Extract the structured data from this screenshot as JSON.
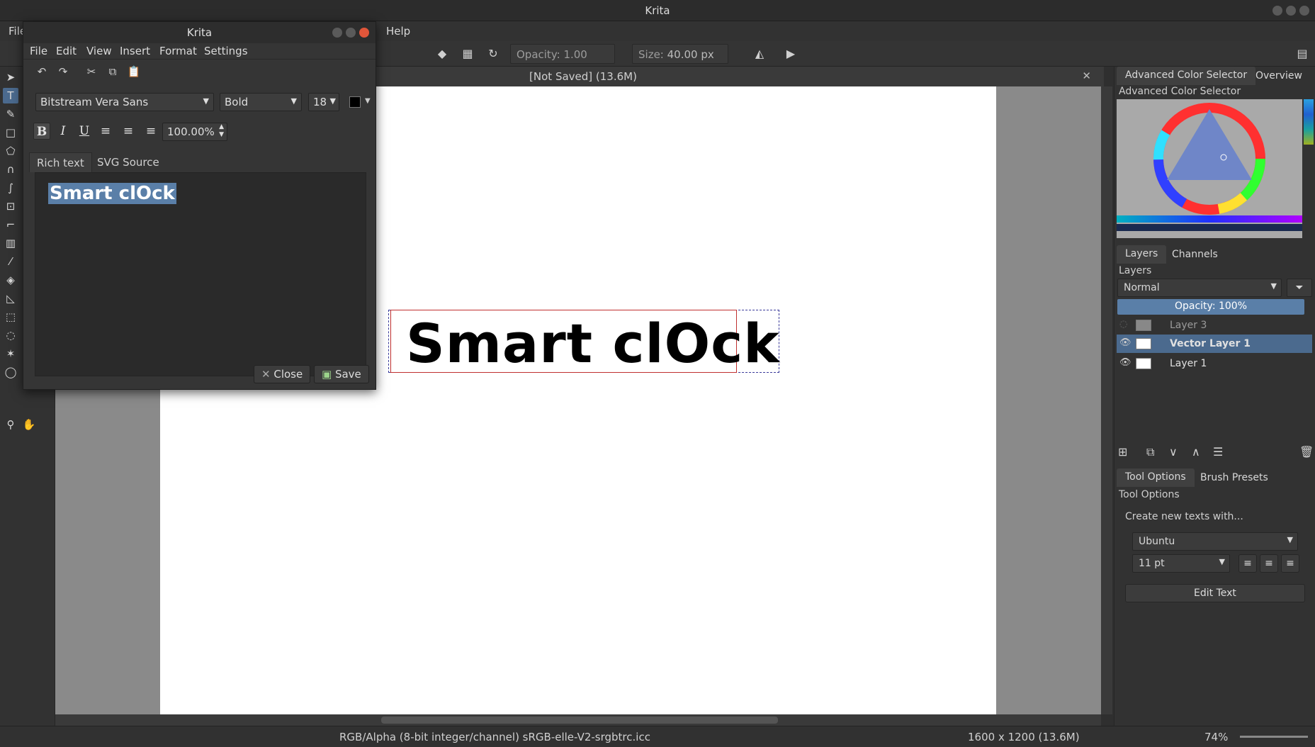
{
  "window": {
    "title": "Krita"
  },
  "menubar": {
    "file": "File",
    "help": "Help"
  },
  "toolbar": {
    "opacity_label": "Opacity:",
    "opacity_value": "1.00",
    "size_label": "Size:",
    "size_value": "40.00 px"
  },
  "document": {
    "tab_title": "[Not Saved]  (13.6M)"
  },
  "canvas": {
    "text": "Smart clOck"
  },
  "statusbar": {
    "color_info": "RGB/Alpha (8-bit integer/channel)  sRGB-elle-V2-srgbtrc.icc",
    "dimensions": "1600 x 1200 (13.6M)",
    "zoom": "74%"
  },
  "dock": {
    "color_tabs": [
      "Advanced Color Selector",
      "Overview"
    ],
    "color_title": "Advanced Color Selector",
    "layer_tabs": [
      "Layers",
      "Channels"
    ],
    "layers_title": "Layers",
    "blend_mode": "Normal",
    "opacity": "Opacity:  100%",
    "layers": [
      {
        "name": "Layer 3",
        "visible": false,
        "selected": false
      },
      {
        "name": "Vector Layer 1",
        "visible": true,
        "selected": true
      },
      {
        "name": "Layer 1",
        "visible": true,
        "selected": false
      }
    ],
    "tool_tabs": [
      "Tool Options",
      "Brush Presets"
    ],
    "tool_title": "Tool Options",
    "create_text_label": "Create new texts with...",
    "font": "Ubuntu",
    "font_size": "11 pt",
    "edit_text_button": "Edit Text"
  },
  "dialog": {
    "title": "Krita",
    "menu": [
      "File",
      "Edit",
      "View",
      "Insert",
      "Format",
      "Settings"
    ],
    "font_family": "Bitstream Vera Sans",
    "font_style": "Bold",
    "font_size": "18",
    "line_spacing": "100.00%",
    "tabs": [
      "Rich text",
      "SVG Source"
    ],
    "editor_text": "Smart clOck",
    "close_button": "Close",
    "save_button": "Save"
  }
}
